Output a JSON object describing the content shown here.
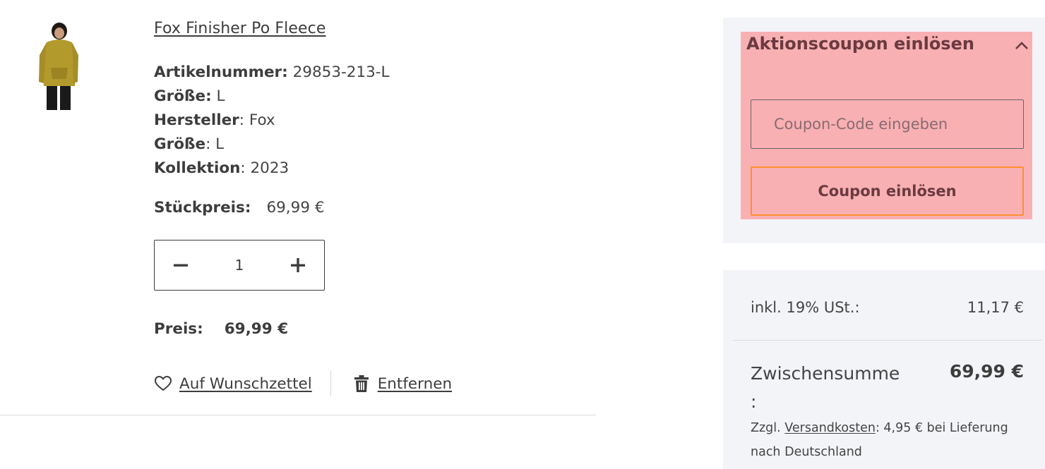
{
  "product": {
    "image_alt": "Fox Finisher Po Fleece",
    "name": "Fox Finisher Po Fleece",
    "attributes": [
      {
        "label": "Artikelnummer:",
        "value": " 29853-213-L"
      },
      {
        "label": "Größe:",
        "value": " L"
      },
      {
        "label": "Hersteller",
        "value": ": Fox"
      },
      {
        "label": "Größe",
        "value": ": L"
      },
      {
        "label": "Kollektion",
        "value": ": 2023"
      }
    ],
    "unit_price_label": "Stückpreis:",
    "unit_price_value": "69,99 €",
    "quantity": "1",
    "price_label": "Preis:",
    "price_value": "69,99 €",
    "wishlist_label": "Auf Wunschzettel",
    "remove_label": "Entfernen"
  },
  "coupon": {
    "title": "Aktionscoupon einlösen",
    "input_placeholder": "Coupon-Code eingeben",
    "button_label": "Coupon einlösen",
    "highlight_color": "#f8b0b3",
    "button_border_color": "#ff8f2e"
  },
  "summary": {
    "vat_label": "inkl. 19% USt.:",
    "vat_value": "11,17 €",
    "subtotal_label": "Zwischensumme :",
    "subtotal_value": "69,99 €",
    "shipping_prefix": "Zzgl. ",
    "shipping_link": "Versandkosten",
    "shipping_suffix": ": 4,95 € bei Lieferung nach Deutschland"
  }
}
